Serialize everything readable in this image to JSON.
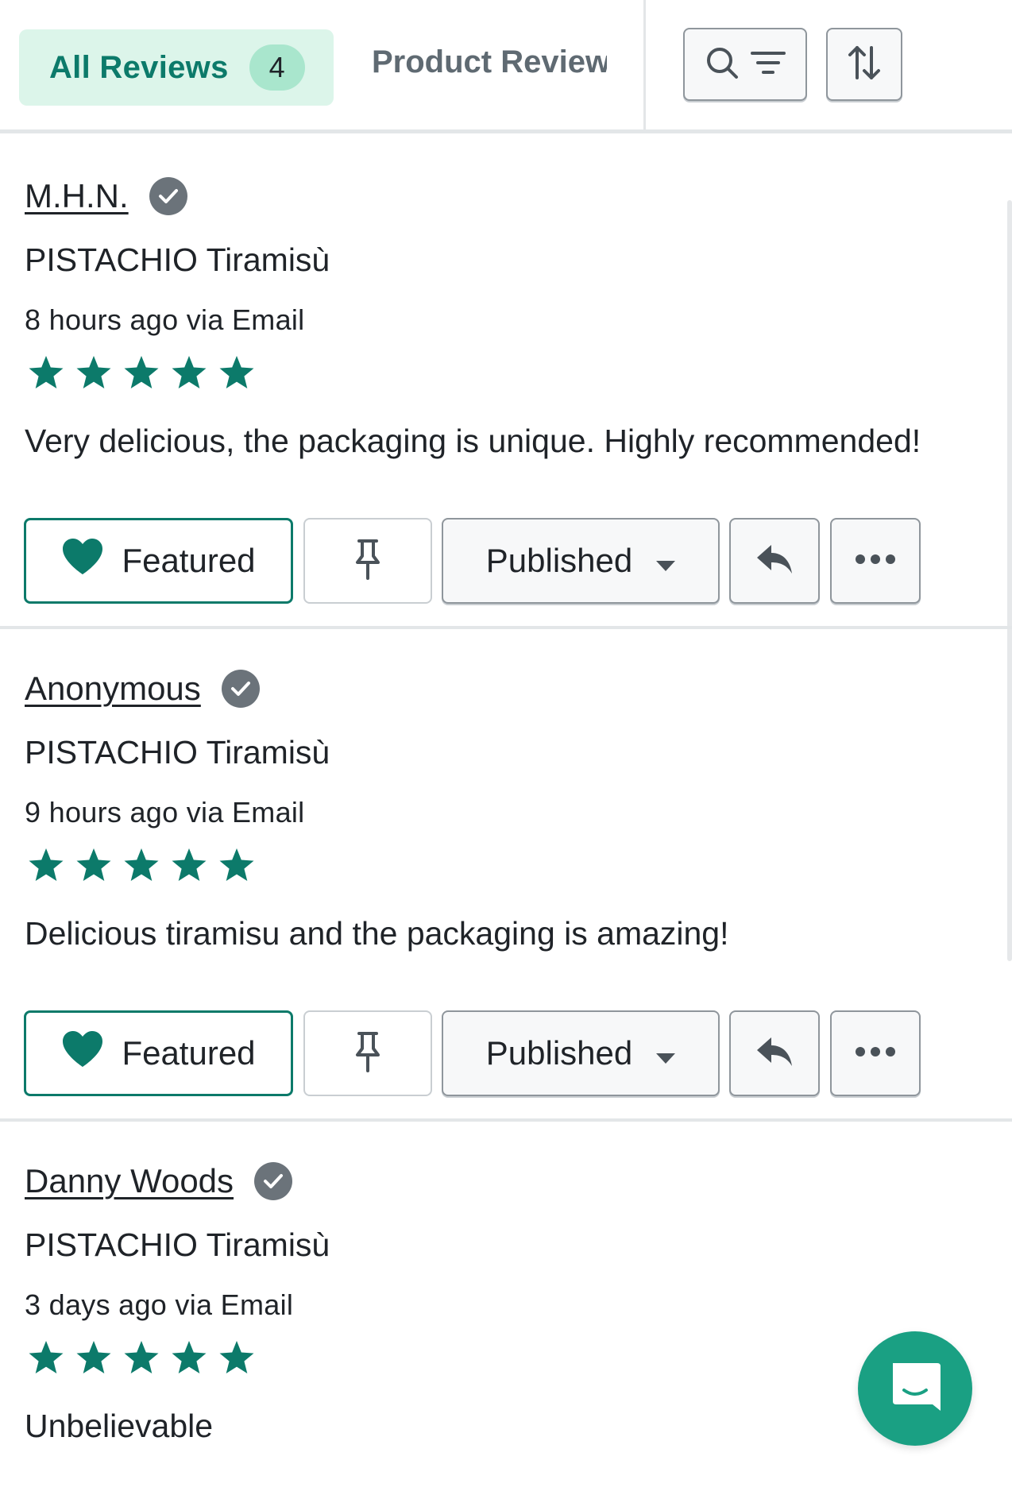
{
  "tabs": {
    "all_reviews": {
      "label": "All Reviews",
      "count": "4"
    },
    "product_reviews": {
      "label": "Product Reviews"
    }
  },
  "toolbar": {
    "search_filter_icon": "search-filter-icon",
    "sort_icon": "sort-arrows-icon"
  },
  "reviews": [
    {
      "author": "M.H.N.",
      "product": "PISTACHIO Tiramisù",
      "meta": "8 hours ago via Email",
      "rating": 5,
      "body": "Very delicious, the packaging is unique. Highly recommended!",
      "featured_label": "Featured",
      "status_label": "Published"
    },
    {
      "author": "Anonymous",
      "product": "PISTACHIO Tiramisù",
      "meta": "9 hours ago via Email",
      "rating": 5,
      "body": "Delicious tiramisu and the packaging is amazing!",
      "featured_label": "Featured",
      "status_label": "Published"
    },
    {
      "author": "Danny Woods",
      "product": "PISTACHIO Tiramisù",
      "meta": "3 days ago via Email",
      "rating": 5,
      "body": "Unbelievable"
    }
  ],
  "colors": {
    "accent": "#0c7a6a",
    "tab_bg": "#dcf5ea",
    "chat_bg": "#1aa083"
  }
}
